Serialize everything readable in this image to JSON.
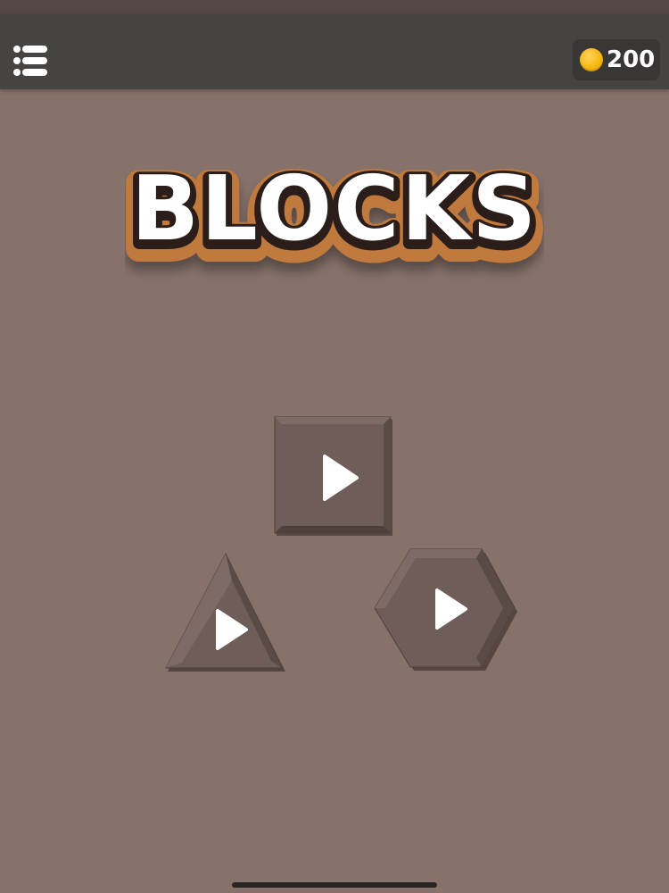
{
  "header": {
    "menu_icon": "list-menu-icon",
    "coins": {
      "icon": "gold-coin-icon",
      "value": "200"
    }
  },
  "title": {
    "text": "BLOCKS"
  },
  "modes": [
    {
      "shape": "square",
      "icon": "play-icon"
    },
    {
      "shape": "triangle",
      "icon": "play-icon"
    },
    {
      "shape": "hexagon",
      "icon": "play-icon"
    }
  ],
  "colors": {
    "background": "#86726a",
    "topbar": "#454443",
    "tile": "#6b5a55",
    "coin": "#f5b40c",
    "title_outline": "#c07a3c",
    "title_fill": "#ffffff"
  }
}
